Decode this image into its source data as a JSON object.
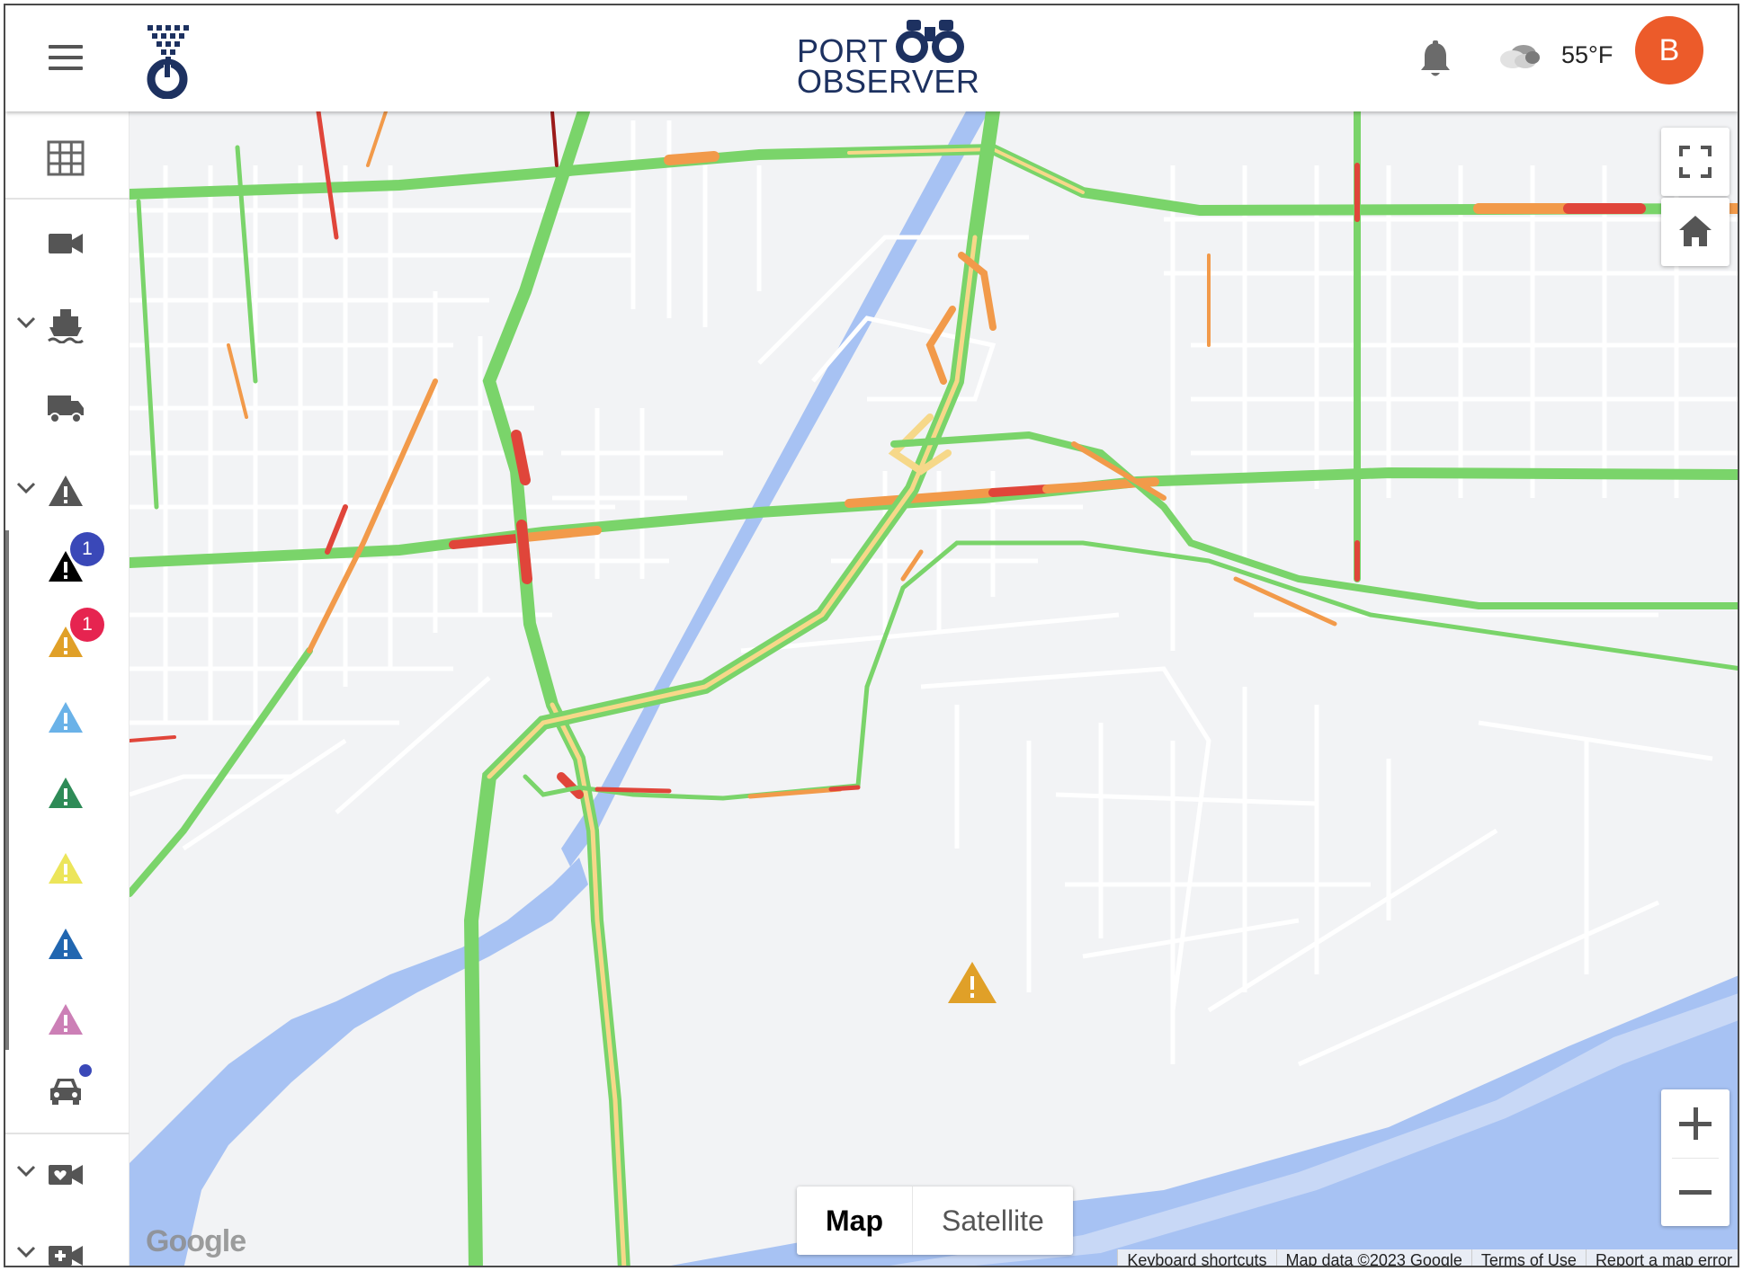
{
  "header": {
    "brand_line1": "PORT",
    "brand_line2": "OBSERVER",
    "temperature": "55°F",
    "avatar_initial": "B",
    "avatar_color": "#ec5b2a",
    "icons": [
      "menu-icon",
      "organization-logo",
      "binoculars-icon",
      "bell-icon",
      "cloudy-icon"
    ]
  },
  "sidebar": {
    "items": [
      {
        "name": "grid-view",
        "icon": "grid-icon"
      },
      {
        "name": "cameras",
        "icon": "video-camera-icon"
      },
      {
        "name": "vessels",
        "icon": "ship-icon",
        "expandable": true
      },
      {
        "name": "trucks",
        "icon": "truck-icon"
      },
      {
        "name": "alerts",
        "icon": "warning-icon",
        "expandable": true
      },
      {
        "name": "alert-black",
        "icon": "warning-icon",
        "color": "#000000",
        "badge": "1",
        "badge_color": "#3a48b8"
      },
      {
        "name": "alert-orange",
        "icon": "warning-icon",
        "color": "#e0a028",
        "badge": "1",
        "badge_color": "#e62450"
      },
      {
        "name": "alert-lightblue",
        "icon": "warning-icon",
        "color": "#6ab2e8"
      },
      {
        "name": "alert-green",
        "icon": "warning-icon",
        "color": "#2e8b57"
      },
      {
        "name": "alert-yellow",
        "icon": "warning-icon",
        "color": "#ece55a"
      },
      {
        "name": "alert-blue",
        "icon": "warning-icon",
        "color": "#2166b0"
      },
      {
        "name": "alert-pink",
        "icon": "warning-icon",
        "color": "#cc7fb6"
      },
      {
        "name": "vehicles",
        "icon": "car-icon"
      },
      {
        "name": "favorite-cameras",
        "icon": "camera-heart-icon",
        "expandable": true
      },
      {
        "name": "add-camera",
        "icon": "camera-plus-icon",
        "expandable": true
      }
    ]
  },
  "map": {
    "type_options": [
      "Map",
      "Satellite"
    ],
    "selected_type": "Map",
    "google_label": "Google",
    "attribution": [
      "Keyboard shortcuts",
      "Map data ©2023 Google",
      "Terms of Use",
      "Report a map error"
    ],
    "controls": [
      "fullscreen-icon",
      "home-icon",
      "zoom-in-icon",
      "zoom-out-icon"
    ],
    "marker_color": "#e0a028",
    "traffic_colors": {
      "free": "#7ad46a",
      "slow": "#f29a4a",
      "heavy": "#e0453a",
      "very_heavy": "#9b1a1a"
    },
    "water_color": "#a7c2f3"
  }
}
